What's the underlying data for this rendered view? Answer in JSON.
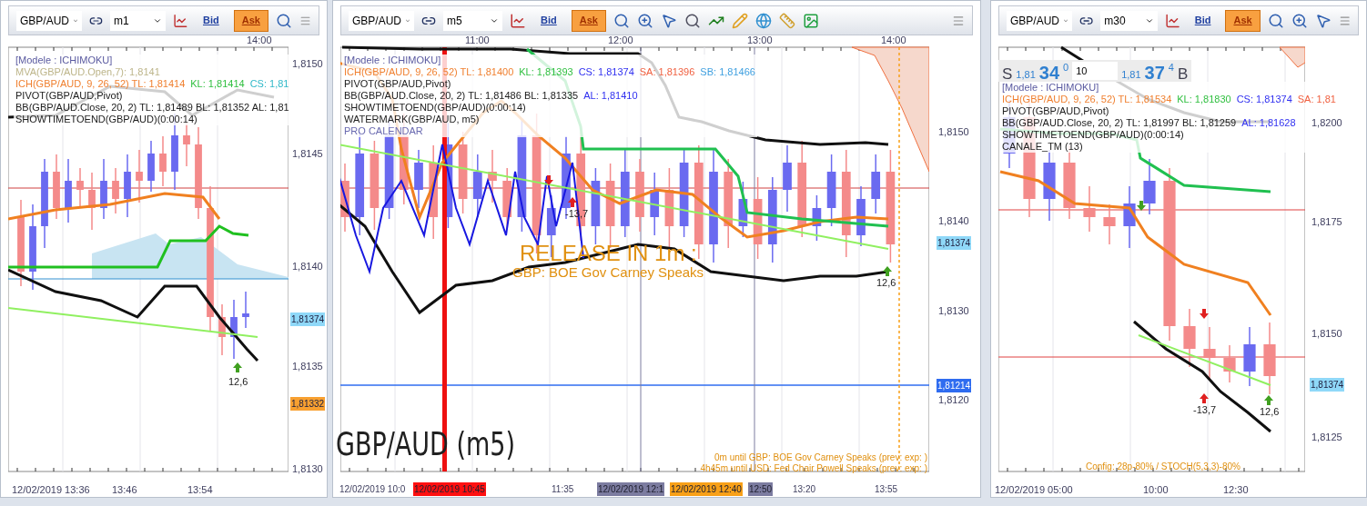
{
  "panels": [
    {
      "symbol": "GBP/AUD",
      "timeframe": "m1",
      "bid": {
        "label": "Bid",
        "selected": false
      },
      "ask": {
        "label": "Ask",
        "selected": true
      },
      "top_times": [
        "14:00"
      ],
      "legend": [
        {
          "segments": [
            {
              "text": "[Modele : ICHIMOKU]",
              "color": "#5a5aa0"
            }
          ]
        },
        {
          "segments": [
            {
              "text": "MVA(GBP/AUD.Open,7): 1,8141",
              "color": "#bdb58a"
            }
          ]
        },
        {
          "segments": [
            {
              "text": "ICH(GBP/AUD, 9, 26, 52)  TL: 1,81414",
              "color": "#f08030"
            },
            {
              "text": "KL: 1,81414",
              "color": "#2fbf3f"
            },
            {
              "text": "CS: 1,81",
              "color": "#30b8c8"
            }
          ]
        },
        {
          "segments": [
            {
              "text": "PIVOT(GBP/AUD,Pivot)",
              "color": "#202020"
            }
          ]
        },
        {
          "segments": [
            {
              "text": "BB(GBP/AUD.Close, 20, 2)  TL: 1,81489  BL: 1,81352  AL: 1,81",
              "color": "#202020"
            }
          ]
        },
        {
          "segments": [
            {
              "text": "SHOWTIMETOEND(GBP/AUD)(0:00:14)",
              "color": "#202020"
            }
          ]
        }
      ],
      "price_labels": [
        {
          "text": "1,8150",
          "kind": "tick"
        },
        {
          "text": "1,8145",
          "kind": "tick"
        },
        {
          "text": "1,8140",
          "kind": "tick"
        },
        {
          "text": "1,81374",
          "kind": "badge",
          "color": "#8fd8f8"
        },
        {
          "text": "1,8135",
          "kind": "tick"
        },
        {
          "text": "1,81332",
          "kind": "badge",
          "color": "#f8a030"
        },
        {
          "text": "1,8130",
          "kind": "tick"
        }
      ],
      "annotations": [
        {
          "text": "12,6",
          "kind": "value"
        }
      ],
      "bottom_times": [
        {
          "text": "12/02/2019 13:36",
          "kind": "plain"
        },
        {
          "text": "13:46",
          "kind": "plain"
        },
        {
          "text": "13:54",
          "kind": "plain"
        }
      ]
    },
    {
      "symbol": "GBP/AUD",
      "timeframe": "m5",
      "bid": {
        "label": "Bid",
        "selected": false
      },
      "ask": {
        "label": "Ask",
        "selected": true
      },
      "top_times": [
        "11:00",
        "12:00",
        "13:00",
        "14:00"
      ],
      "legend": [
        {
          "segments": [
            {
              "text": "[Modele : ICHIMOKU]",
              "color": "#5a5aa0"
            }
          ]
        },
        {
          "segments": [
            {
              "text": "ICH(GBP/AUD, 9, 26, 52)  TL: 1,81400",
              "color": "#f08030"
            },
            {
              "text": "KL: 1,81393",
              "color": "#2fbf3f"
            },
            {
              "text": "CS: 1,81374",
              "color": "#3030f0"
            },
            {
              "text": "SA: 1,81396",
              "color": "#f06040"
            },
            {
              "text": "SB: 1,81466",
              "color": "#40a0e0"
            }
          ]
        },
        {
          "segments": [
            {
              "text": "PIVOT(GBP/AUD,Pivot)",
              "color": "#202020"
            }
          ]
        },
        {
          "segments": [
            {
              "text": "BB(GBP/AUD.Close, 20, 2)  TL: 1,81486  BL: 1,81335",
              "color": "#202020"
            },
            {
              "text": "AL: 1,81410",
              "color": "#3030f0"
            }
          ]
        },
        {
          "segments": [
            {
              "text": "SHOWTIMETOEND(GBP/AUD)(0:00:14)",
              "color": "#202020"
            }
          ]
        },
        {
          "segments": [
            {
              "text": "WATERMARK(GBP/AUD, m5)",
              "color": "#202020"
            }
          ]
        },
        {
          "segments": [
            {
              "text": "PRO CALENDAR",
              "color": "#6a6ab0"
            }
          ]
        }
      ],
      "price_labels": [
        {
          "text": "1,8150",
          "kind": "tick"
        },
        {
          "text": "1,8140",
          "kind": "tick"
        },
        {
          "text": "1,81374",
          "kind": "badge",
          "color": "#8fd8f8"
        },
        {
          "text": "1,8130",
          "kind": "tick"
        },
        {
          "text": "1,81214",
          "kind": "badge",
          "color": "#2f6cf0"
        },
        {
          "text": "1,8120",
          "kind": "tick"
        }
      ],
      "annotations": [
        {
          "text": "-13,7",
          "kind": "value"
        },
        {
          "text": "RELEASE IN 1m :",
          "kind": "release"
        },
        {
          "text": "GBP: BOE Gov Carney Speaks",
          "kind": "release_sub"
        },
        {
          "text": "12,6",
          "kind": "value"
        },
        {
          "text": "GBP/AUD (m5)",
          "kind": "watermark"
        },
        {
          "text": "0m until GBP: BOE Gov Carney Speaks (prev: exp: )",
          "kind": "calendar"
        },
        {
          "text": "4h45m until USD: Fed Chair Powell Speaks (prev: exp: )",
          "kind": "calendar"
        }
      ],
      "bottom_times": [
        {
          "text": "12/02/2019 10:0",
          "kind": "plain"
        },
        {
          "text": "12/02/2019 10:45",
          "kind": "badge",
          "color": "#ff1010"
        },
        {
          "text": "11:35",
          "kind": "plain"
        },
        {
          "text": "12/02/2019 12:1",
          "kind": "badge",
          "color": "#7c7ca0"
        },
        {
          "text": "12/02/2019 12:40",
          "kind": "badge",
          "color": "#f8a018"
        },
        {
          "text": "12:50",
          "kind": "badge",
          "color": "#7c7ca0"
        },
        {
          "text": "13:20",
          "kind": "plain"
        },
        {
          "text": "13:55",
          "kind": "plain"
        }
      ]
    },
    {
      "symbol": "GBP/AUD",
      "timeframe": "m30",
      "bid": {
        "label": "Bid",
        "selected": false
      },
      "ask": {
        "label": "Ask",
        "selected": true
      },
      "quote": {
        "sell_label": "S",
        "sell_small": "1,81",
        "sell_big": "34",
        "sell_sup": "0",
        "quantity": "10",
        "buy_small": "1,81",
        "buy_big": "37",
        "buy_sup": "4",
        "buy_label": "B"
      },
      "legend": [
        {
          "segments": [
            {
              "text": "[Modele : ICHIMOKU]",
              "color": "#5a5aa0"
            }
          ]
        },
        {
          "segments": [
            {
              "text": "ICH(GBP/AUD, 9, 26, 52)  TL: 1,81534",
              "color": "#f08030"
            },
            {
              "text": "KL: 1,81830",
              "color": "#2fbf3f"
            },
            {
              "text": "CS: 1,81374",
              "color": "#3030f0"
            },
            {
              "text": "SA: 1,81",
              "color": "#f06040"
            }
          ]
        },
        {
          "segments": [
            {
              "text": "PIVOT(GBP/AUD,Pivot)",
              "color": "#202020"
            }
          ]
        },
        {
          "segments": [
            {
              "text": "BB(GBP/AUD.Close, 20, 2)  TL: 1,81997  BL: 1,81259",
              "color": "#202020"
            },
            {
              "text": "AL: 1,81628",
              "color": "#3030f0"
            }
          ]
        },
        {
          "segments": [
            {
              "text": "SHOWTIMETOEND(GBP/AUD)(0:00:14)",
              "color": "#202020"
            }
          ]
        },
        {
          "segments": [
            {
              "text": "CANALE_TM (13)",
              "color": "#202020"
            }
          ]
        }
      ],
      "price_labels": [
        {
          "text": "1,8200",
          "kind": "tick"
        },
        {
          "text": "1,8175",
          "kind": "tick"
        },
        {
          "text": "1,8150",
          "kind": "tick"
        },
        {
          "text": "1,81374",
          "kind": "badge",
          "color": "#8fd8f8"
        },
        {
          "text": "1,8125",
          "kind": "tick"
        }
      ],
      "annotations": [
        {
          "text": "-13,7",
          "kind": "value"
        },
        {
          "text": "12,6",
          "kind": "value"
        },
        {
          "text": "Config: 28p-80% / STOCH(5,3,3)-80%",
          "kind": "config"
        }
      ],
      "bottom_times": [
        {
          "text": "12/02/2019 05:00",
          "kind": "plain"
        },
        {
          "text": "10:00",
          "kind": "plain"
        },
        {
          "text": "12:30",
          "kind": "plain"
        }
      ]
    }
  ]
}
